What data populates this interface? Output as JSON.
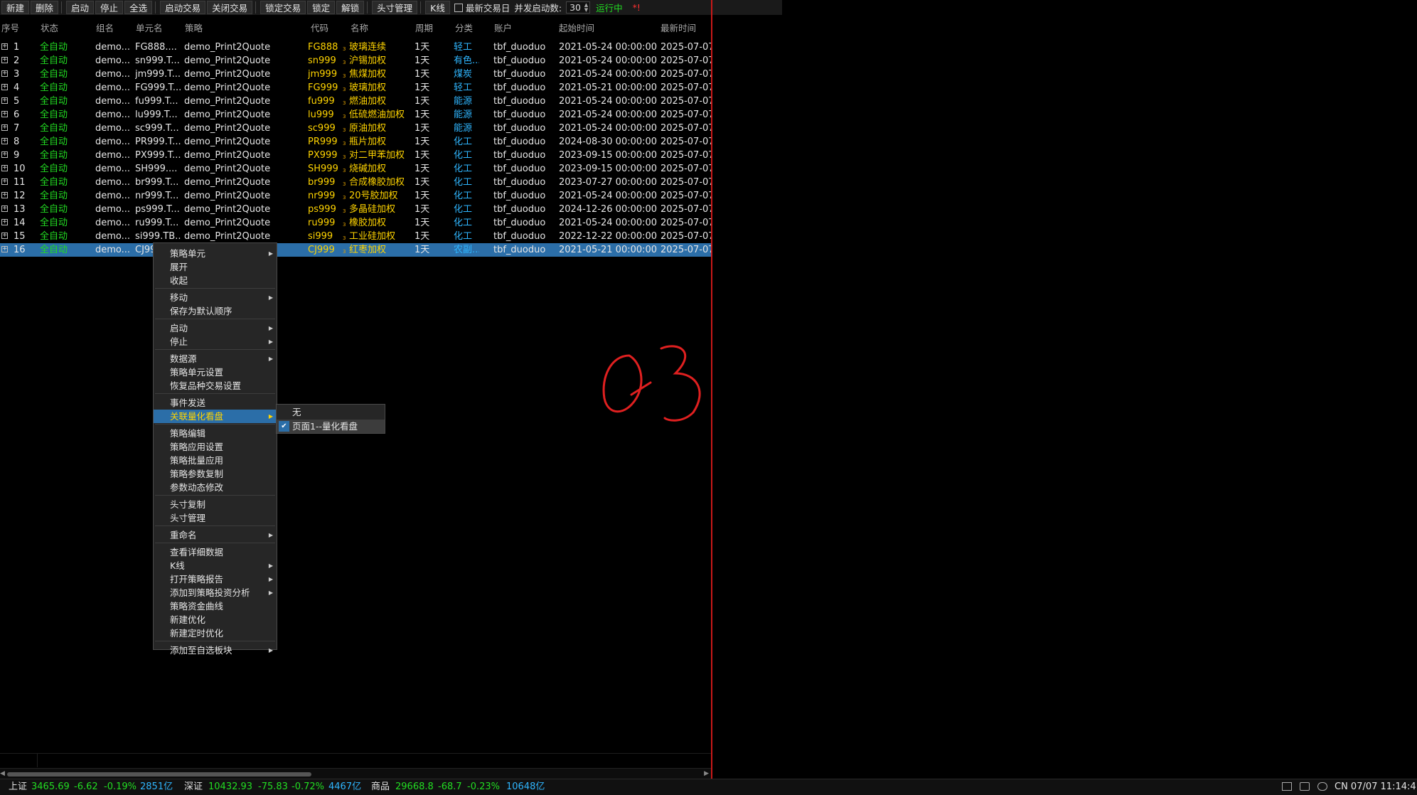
{
  "toolbar": {
    "new": "新建",
    "delete": "删除",
    "start": "启动",
    "stop": "停止",
    "select_all": "全选",
    "start_trade": "启动交易",
    "close_trade": "关闭交易",
    "lock_trade": "锁定交易",
    "lock": "锁定",
    "unlock": "解锁",
    "position_mgmt": "头寸管理",
    "kline": "K线",
    "latest_trade_day": "最新交易日",
    "concurrency_label": "并发启动数:",
    "concurrency_value": "30",
    "status": "运行中",
    "mark": "*!"
  },
  "table": {
    "headers": {
      "idx": "序号",
      "status": "状态",
      "group": "组名",
      "unit": "单元名",
      "strategy": "策略",
      "code": "代码",
      "name": "名称",
      "period": "周期",
      "category": "分类",
      "account": "账户",
      "start_time": "起始时间",
      "last_time": "最新时间"
    },
    "rows": [
      {
        "idx": "1",
        "status": "全自动",
        "group": "demo...",
        "unit": "FG888....",
        "strategy": "demo_Print2Quote",
        "code": "FG888",
        "dot": "3",
        "name": "玻璃连续",
        "period": "1天",
        "category": "轻工",
        "account": "tbf_duoduo",
        "start": "2021-05-24 00:00:00",
        "last": "2025-07-07"
      },
      {
        "idx": "2",
        "status": "全自动",
        "group": "demo...",
        "unit": "sn999.T...",
        "strategy": "demo_Print2Quote",
        "code": "sn999",
        "dot": "3",
        "name": "沪锡加权",
        "period": "1天",
        "category": "有色...",
        "account": "tbf_duoduo",
        "start": "2021-05-24 00:00:00",
        "last": "2025-07-07"
      },
      {
        "idx": "3",
        "status": "全自动",
        "group": "demo...",
        "unit": "jm999.T...",
        "strategy": "demo_Print2Quote",
        "code": "jm999",
        "dot": "3",
        "name": "焦煤加权",
        "period": "1天",
        "category": "煤炭",
        "account": "tbf_duoduo",
        "start": "2021-05-24 00:00:00",
        "last": "2025-07-07"
      },
      {
        "idx": "4",
        "status": "全自动",
        "group": "demo...",
        "unit": "FG999.T...",
        "strategy": "demo_Print2Quote",
        "code": "FG999",
        "dot": "3",
        "name": "玻璃加权",
        "period": "1天",
        "category": "轻工",
        "account": "tbf_duoduo",
        "start": "2021-05-21 00:00:00",
        "last": "2025-07-07"
      },
      {
        "idx": "5",
        "status": "全自动",
        "group": "demo...",
        "unit": "fu999.T...",
        "strategy": "demo_Print2Quote",
        "code": "fu999",
        "dot": "3",
        "name": "燃油加权",
        "period": "1天",
        "category": "能源",
        "account": "tbf_duoduo",
        "start": "2021-05-24 00:00:00",
        "last": "2025-07-07"
      },
      {
        "idx": "6",
        "status": "全自动",
        "group": "demo...",
        "unit": "lu999.T...",
        "strategy": "demo_Print2Quote",
        "code": "lu999",
        "dot": "3",
        "name": "低硫燃油加权",
        "period": "1天",
        "category": "能源",
        "account": "tbf_duoduo",
        "start": "2021-05-24 00:00:00",
        "last": "2025-07-07"
      },
      {
        "idx": "7",
        "status": "全自动",
        "group": "demo...",
        "unit": "sc999.T...",
        "strategy": "demo_Print2Quote",
        "code": "sc999",
        "dot": "3",
        "name": "原油加权",
        "period": "1天",
        "category": "能源",
        "account": "tbf_duoduo",
        "start": "2021-05-24 00:00:00",
        "last": "2025-07-07"
      },
      {
        "idx": "8",
        "status": "全自动",
        "group": "demo...",
        "unit": "PR999.T...",
        "strategy": "demo_Print2Quote",
        "code": "PR999",
        "dot": "3",
        "name": "瓶片加权",
        "period": "1天",
        "category": "化工",
        "account": "tbf_duoduo",
        "start": "2024-08-30 00:00:00",
        "last": "2025-07-07"
      },
      {
        "idx": "9",
        "status": "全自动",
        "group": "demo...",
        "unit": "PX999.T...",
        "strategy": "demo_Print2Quote",
        "code": "PX999",
        "dot": "3",
        "name": "对二甲苯加权",
        "period": "1天",
        "category": "化工",
        "account": "tbf_duoduo",
        "start": "2023-09-15 00:00:00",
        "last": "2025-07-07"
      },
      {
        "idx": "10",
        "status": "全自动",
        "group": "demo...",
        "unit": "SH999....",
        "strategy": "demo_Print2Quote",
        "code": "SH999",
        "dot": "3",
        "name": "烧碱加权",
        "period": "1天",
        "category": "化工",
        "account": "tbf_duoduo",
        "start": "2023-09-15 00:00:00",
        "last": "2025-07-07"
      },
      {
        "idx": "11",
        "status": "全自动",
        "group": "demo...",
        "unit": "br999.T...",
        "strategy": "demo_Print2Quote",
        "code": "br999",
        "dot": "3",
        "name": "合成橡胶加权",
        "period": "1天",
        "category": "化工",
        "account": "tbf_duoduo",
        "start": "2023-07-27 00:00:00",
        "last": "2025-07-07"
      },
      {
        "idx": "12",
        "status": "全自动",
        "group": "demo...",
        "unit": "nr999.T...",
        "strategy": "demo_Print2Quote",
        "code": "nr999",
        "dot": "3",
        "name": "20号胶加权",
        "period": "1天",
        "category": "化工",
        "account": "tbf_duoduo",
        "start": "2021-05-24 00:00:00",
        "last": "2025-07-07"
      },
      {
        "idx": "13",
        "status": "全自动",
        "group": "demo...",
        "unit": "ps999.T...",
        "strategy": "demo_Print2Quote",
        "code": "ps999",
        "dot": "3",
        "name": "多晶硅加权",
        "period": "1天",
        "category": "化工",
        "account": "tbf_duoduo",
        "start": "2024-12-26 00:00:00",
        "last": "2025-07-07"
      },
      {
        "idx": "14",
        "status": "全自动",
        "group": "demo...",
        "unit": "ru999.T...",
        "strategy": "demo_Print2Quote",
        "code": "ru999",
        "dot": "3",
        "name": "橡胶加权",
        "period": "1天",
        "category": "化工",
        "account": "tbf_duoduo",
        "start": "2021-05-24 00:00:00",
        "last": "2025-07-07"
      },
      {
        "idx": "15",
        "status": "全自动",
        "group": "demo...",
        "unit": "si999.TB...",
        "strategy": "demo_Print2Quote",
        "code": "si999",
        "dot": "3",
        "name": "工业硅加权",
        "period": "1天",
        "category": "化工",
        "account": "tbf_duoduo",
        "start": "2022-12-22 00:00:00",
        "last": "2025-07-07"
      },
      {
        "idx": "16",
        "status": "全自动",
        "group": "demo...",
        "unit": "CJ999",
        "strategy": "demo_Print2Quote",
        "code": "CJ999",
        "dot": "3",
        "name": "红枣加权",
        "period": "1天",
        "category": "农副...",
        "account": "tbf_duoduo",
        "start": "2021-05-21 00:00:00",
        "last": "2025-07-07"
      }
    ]
  },
  "context_menu": {
    "items": [
      "策略单元",
      "展开",
      "收起",
      "移动",
      "保存为默认顺序",
      "启动",
      "停止",
      "数据源",
      "策略单元设置",
      "恢复品种交易设置",
      "事件发送",
      "关联量化看盘",
      "策略编辑",
      "策略应用设置",
      "策略批量应用",
      "策略参数复制",
      "参数动态修改",
      "头寸复制",
      "头寸管理",
      "重命名",
      "查看详细数据",
      "K线",
      "打开策略报告",
      "添加到策略投资分析",
      "策略资金曲线",
      "新建优化",
      "新建定时优化",
      "添加至自选板块"
    ]
  },
  "submenu": {
    "none": "无",
    "page1": "页面1--量化看盘"
  },
  "annotation": "Q3",
  "status_bar": {
    "sh_label": "上证",
    "sh_price": "3465.69",
    "sh_chg": "-6.62",
    "sh_pct": "-0.19%",
    "sh_vol": "2851亿",
    "sz_label": "深证",
    "sz_price": "10432.93",
    "sz_chg": "-75.83",
    "sz_pct": "-0.72%",
    "sz_vol": "4467亿",
    "cm_label": "商品",
    "cm_price": "29668.8",
    "cm_chg": "-68.7",
    "cm_pct": "-0.23%",
    "cm_vol": "10648亿",
    "clock": "CN 07/07 11:14:4"
  },
  "colors": {
    "positive": "#22dd22",
    "category": "#2fb6ff",
    "code": "#ffd400",
    "selection": "#2b6ea8",
    "accent_red": "#c81818"
  }
}
